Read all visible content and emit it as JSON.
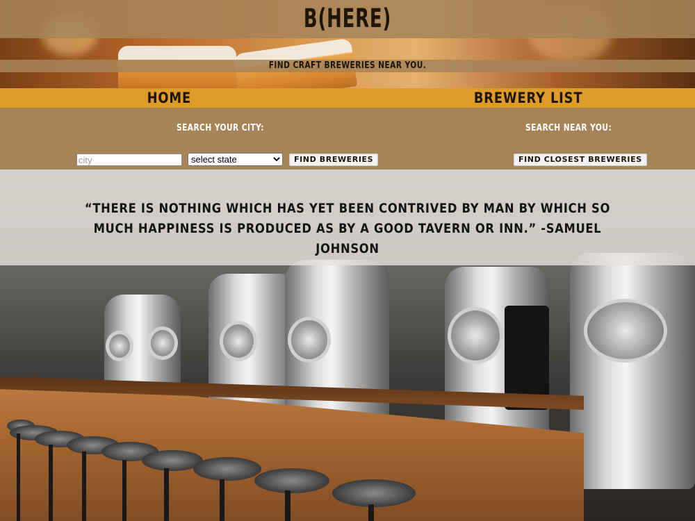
{
  "brand": "B(HERE)",
  "tagline": "FIND CRAFT BREWERIES NEAR YOU.",
  "nav": {
    "home": "HOME",
    "list": "BREWERY LIST"
  },
  "search": {
    "city_label": "SEARCH YOUR CITY:",
    "city_placeholder": "city",
    "state_selected": "select state",
    "find_button": "FIND BREWERIES",
    "near_label": "SEARCH NEAR YOU:",
    "closest_button": "FIND CLOSEST BREWERIES"
  },
  "quote": "“THERE IS NOTHING WHICH HAS YET BEEN CONTRIVED BY MAN BY WHICH SO MUCH HAPPINESS IS PRODUCED AS BY A GOOD TAVERN OR INN.” -SAMUEL JOHNSON",
  "colors": {
    "header_band": "#a68458",
    "nav_band": "#eba528",
    "text_dark": "#1e1408"
  }
}
